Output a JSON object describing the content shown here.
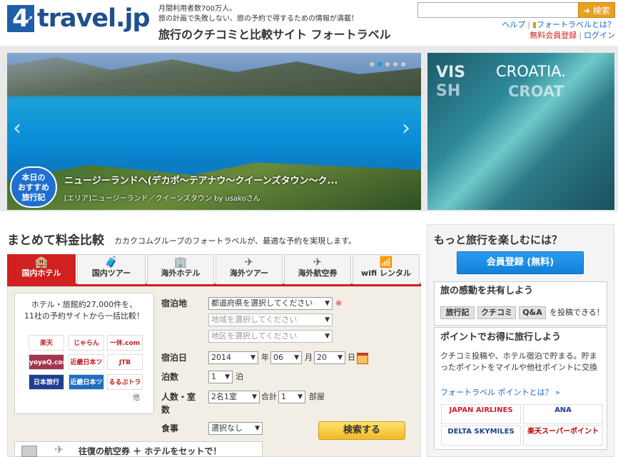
{
  "header": {
    "logo_text": "travel.jp",
    "logo_digit": "4",
    "tagline_1": "月間利用者数700万人。",
    "tagline_2": "旅の計画で失敗しない、旅の予約で得するための情報が満載！",
    "tagline_main": "旅行のクチコミと比較サイト フォートラベル",
    "search_placeholder": "",
    "search_button": "検索",
    "links": {
      "help": "ヘルプ",
      "about": "フォートラベルとは？",
      "register": "無料会員登録",
      "login": "ログイン"
    }
  },
  "hero": {
    "badge": [
      "本日の",
      "おすすめ",
      "旅行記"
    ],
    "title": "ニュージーランドへ(デカポ～テアナウ～クイーンズタウン～ク...",
    "subtitle": "[エリア]ニュージーランド／クイーンズタウン by usakoさん",
    "dots": 5,
    "active_dot": 1,
    "side_text": [
      "VIS",
      "SH",
      "CROATIA.",
      "CROAT"
    ]
  },
  "compare": {
    "title": "まとめて料金比較",
    "description": "カカクコムグループのフォートラベルが、最適な予約を実現します。",
    "tabs": [
      {
        "label": "国内ホテル",
        "icon": "🏨",
        "active": true
      },
      {
        "label": "国内ツアー",
        "icon": "🧳",
        "active": false
      },
      {
        "label": "海外ホテル",
        "icon": "🏢",
        "active": false
      },
      {
        "label": "海外ツアー",
        "icon": "✈",
        "active": false
      },
      {
        "label": "海外航空券",
        "icon": "✈",
        "active": false
      },
      {
        "label": "wifi レンタル",
        "icon": "📶",
        "active": false
      }
    ],
    "hotel_text_1": "ホテル・旅館約27,000件を、",
    "hotel_text_2": "11社の予約サイトから一括比較！",
    "logos": [
      "楽天",
      "じゃらん",
      "一休.com",
      "yoyaQ.com",
      "近畿日本ツーリスト",
      "JTB",
      "日本旅行",
      "近畿日本ツーリスト",
      "るるぶトラベル"
    ],
    "logo_colors": [
      "#fff",
      "#fff",
      "#fff",
      "#a3364b",
      "#fff",
      "#fff",
      "#1f3f8f",
      "#1e6fc0",
      "#fff"
    ],
    "other": "他",
    "form": {
      "destination_label": "宿泊地",
      "prefecture": "都道府県を選択してください",
      "region": "地域を選択してください",
      "district": "地区を選択してください",
      "required": "※",
      "date_label": "宿泊日",
      "year": "2014",
      "year_unit": "年",
      "month": "06",
      "month_unit": "月",
      "day": "20",
      "day_unit": "日",
      "nights_label": "泊数",
      "nights": "1",
      "nights_unit": "泊",
      "people_label_1": "人数・室",
      "people_label_2": "数",
      "people": "2名1室",
      "total_label": "合計",
      "rooms": "1",
      "rooms_unit": "部屋",
      "meal_label": "食事",
      "meal": "選択なし",
      "search_button": "検索する"
    },
    "air_hotel": "往復の航空券 ＋ ホテルをセットで！"
  },
  "right": {
    "title": "もっと旅行を楽しむには？",
    "register_button": "会員登録 (無料)",
    "share_title": "旅の感動を共有しよう",
    "share_chips": [
      "旅行記",
      "クチコミ",
      "Q&A"
    ],
    "share_suffix": "を投稿できる！",
    "point_title": "ポイントでお得に旅行しよう",
    "point_desc": "クチコミ投稿や、ホテル宿泊で貯まる。貯まったポイントをマイルや他社ポイントに交換",
    "point_link": "フォートラベル ポイントとは？ »",
    "partners": [
      "JAPAN AIRLINES",
      "ANA",
      "DELTA SKYMILES",
      "楽天スーパーポイント"
    ],
    "partner_colors": [
      "#d0202a",
      "#1b3f8f",
      "#1b3f8f",
      "#c00000"
    ]
  }
}
